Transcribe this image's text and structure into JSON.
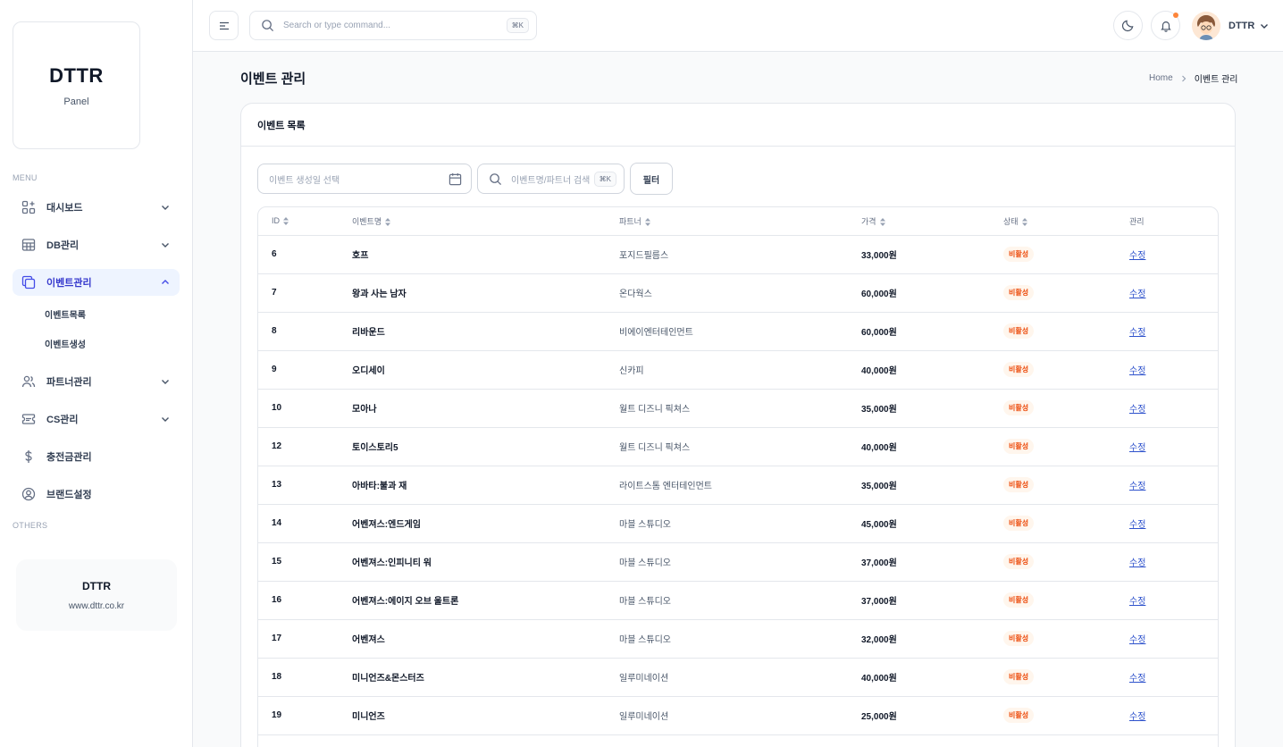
{
  "brand": {
    "title": "DTTR",
    "subtitle": "Panel"
  },
  "sidebar": {
    "menu_label": "MENU",
    "others_label": "OTHERS",
    "items": [
      {
        "label": "대시보드",
        "icon": "grid-plus-icon"
      },
      {
        "label": "DB관리",
        "icon": "table-icon"
      },
      {
        "label": "이벤트관리",
        "icon": "copy-icon",
        "active": true,
        "sub": [
          "이벤트목록",
          "이벤트생성"
        ]
      },
      {
        "label": "파트너관리",
        "icon": "users-icon"
      },
      {
        "label": "CS관리",
        "icon": "ticket-icon"
      },
      {
        "label": "충전금관리",
        "icon": "dollar-icon"
      },
      {
        "label": "브랜드설정",
        "icon": "user-circle-icon"
      }
    ],
    "promo": {
      "title": "DTTR",
      "url": "www.dttr.co.kr"
    }
  },
  "header": {
    "search_placeholder": "Search or type command...",
    "search_shortcut": "⌘K",
    "user_name": "DTTR"
  },
  "page": {
    "title": "이벤트 관리",
    "breadcrumb": {
      "home": "Home",
      "current": "이벤트 관리"
    }
  },
  "card": {
    "title": "이벤트 목록",
    "date_placeholder": "이벤트 생성일 선택",
    "search_placeholder": "이벤트명/파트너 검색",
    "search_shortcut": "⌘K",
    "filter_label": "필터"
  },
  "table": {
    "columns": [
      "ID",
      "이벤트명",
      "파트너",
      "가격",
      "상태",
      "관리"
    ],
    "rows": [
      {
        "id": "6",
        "name": "호프",
        "partner": "포지드필름스",
        "price": "33,000원",
        "status": "비활성",
        "action": "수정"
      },
      {
        "id": "7",
        "name": "왕과 사는 남자",
        "partner": "온다웍스",
        "price": "60,000원",
        "status": "비활성",
        "action": "수정"
      },
      {
        "id": "8",
        "name": "리바운드",
        "partner": "비에이엔터테인먼트",
        "price": "60,000원",
        "status": "비활성",
        "action": "수정"
      },
      {
        "id": "9",
        "name": "오디세이",
        "partner": "신카피",
        "price": "40,000원",
        "status": "비활성",
        "action": "수정"
      },
      {
        "id": "10",
        "name": "모아나",
        "partner": "월트 디즈니 픽쳐스",
        "price": "35,000원",
        "status": "비활성",
        "action": "수정"
      },
      {
        "id": "12",
        "name": "토이스토리5",
        "partner": "월트 디즈니 픽쳐스",
        "price": "40,000원",
        "status": "비활성",
        "action": "수정"
      },
      {
        "id": "13",
        "name": "아바타:불과 재",
        "partner": "라이트스톰 엔터테인먼트",
        "price": "35,000원",
        "status": "비활성",
        "action": "수정"
      },
      {
        "id": "14",
        "name": "어벤져스:엔드게임",
        "partner": "마블 스튜디오",
        "price": "45,000원",
        "status": "비활성",
        "action": "수정"
      },
      {
        "id": "15",
        "name": "어벤져스:인피니티 워",
        "partner": "마블 스튜디오",
        "price": "37,000원",
        "status": "비활성",
        "action": "수정"
      },
      {
        "id": "16",
        "name": "어벤져스:에이지 오브 울트론",
        "partner": "마블 스튜디오",
        "price": "37,000원",
        "status": "비활성",
        "action": "수정"
      },
      {
        "id": "17",
        "name": "어벤져스",
        "partner": "마블 스튜디오",
        "price": "32,000원",
        "status": "비활성",
        "action": "수정"
      },
      {
        "id": "18",
        "name": "미니언즈&몬스터즈",
        "partner": "일루미네이션",
        "price": "40,000원",
        "status": "비활성",
        "action": "수정"
      },
      {
        "id": "19",
        "name": "미니언즈",
        "partner": "일루미네이션",
        "price": "25,000원",
        "status": "비활성",
        "action": "수정"
      }
    ]
  },
  "colors": {
    "accent": "#444ce7",
    "badge_text": "#ec4a0a",
    "badge_bg": "#fff6ed",
    "notif_dot": "#fd853a"
  }
}
